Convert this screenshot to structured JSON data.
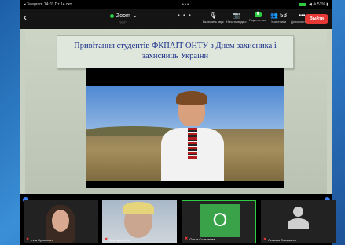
{
  "status_bar": {
    "left": "◂ Telegram  14:03  Пт 14 окт.",
    "dots": "• • •",
    "right": "◀ ❊ 51% ▮"
  },
  "toolbar": {
    "back": "‹",
    "title": "Zoom",
    "title_sub": "\"???\"",
    "more": "• • •",
    "buttons": [
      {
        "icon": "🎙",
        "label": "Включить звук"
      },
      {
        "icon": "📷",
        "label": "Начать видео"
      },
      {
        "icon": "⬆",
        "label": "Поделиться"
      },
      {
        "icon": "👥 53",
        "label": "Участники"
      },
      {
        "icon": "•••",
        "label": "Дополнительно"
      }
    ],
    "leave": "Выйти"
  },
  "slide": {
    "title_line1": "Привітання студентів ФКПАІТ ОНТУ  з Днем захисника і",
    "title_line2": "захисниць України"
  },
  "participants": [
    {
      "name": "Інна Сухомлин"
    },
    {
      "name": "Ана Цюпа Ана"
    },
    {
      "name": "Ольга Солтанова",
      "initial": "О"
    },
    {
      "name": "Легкова Єлизавета"
    }
  ],
  "colors": {
    "accent": "#2ecc40",
    "leave": "#e53935",
    "title": "#1a2f8a"
  }
}
